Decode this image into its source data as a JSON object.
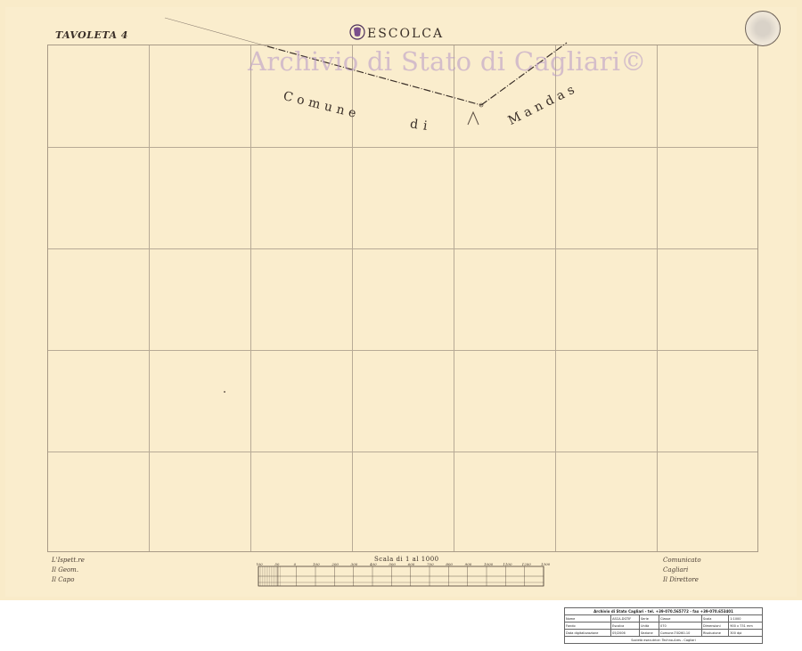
{
  "map": {
    "sheet_label": "TAVOLETA 4",
    "town": "ESCOLCA",
    "watermark": "Archivio di Stato di Cagliari©",
    "comune_word": "Comune",
    "di_word": "di",
    "mandas_word": "Mandas",
    "scale_title": "Scala di 1 al 1000",
    "scale_ticks": [
      "100",
      "50",
      "0",
      "100",
      "200",
      "300",
      "400",
      "500",
      "600",
      "700",
      "800",
      "900",
      "1000",
      "1100",
      "1200",
      "1300"
    ],
    "colors": {
      "paper": "#f9ebc9",
      "ink": "#3a2f28",
      "grid": "#b7aa96",
      "watermark": "#b496c8"
    }
  },
  "info_table": {
    "header": "Archivio di Stato Cagliari - tel. +39-070.565772 - fax +39-070.653401",
    "rows": [
      [
        "Nome",
        "ASCA-DGTIF",
        "Serie",
        "Classe",
        "Scala",
        "1:1000"
      ],
      [
        "Fondo",
        "Escolca",
        "Unità",
        "070",
        "Dimensioni",
        "900 x 731 mm"
      ],
      [
        "Data digitalizzazione",
        "05/2006",
        "Sezione",
        "Comune-TI0260-10",
        "Risoluzione",
        "300 dpi"
      ]
    ],
    "footer": "Società esecutrice: Techno-Ares - Cagliari"
  },
  "icons": [
    "crest-icon",
    "seal-stamp-icon"
  ]
}
